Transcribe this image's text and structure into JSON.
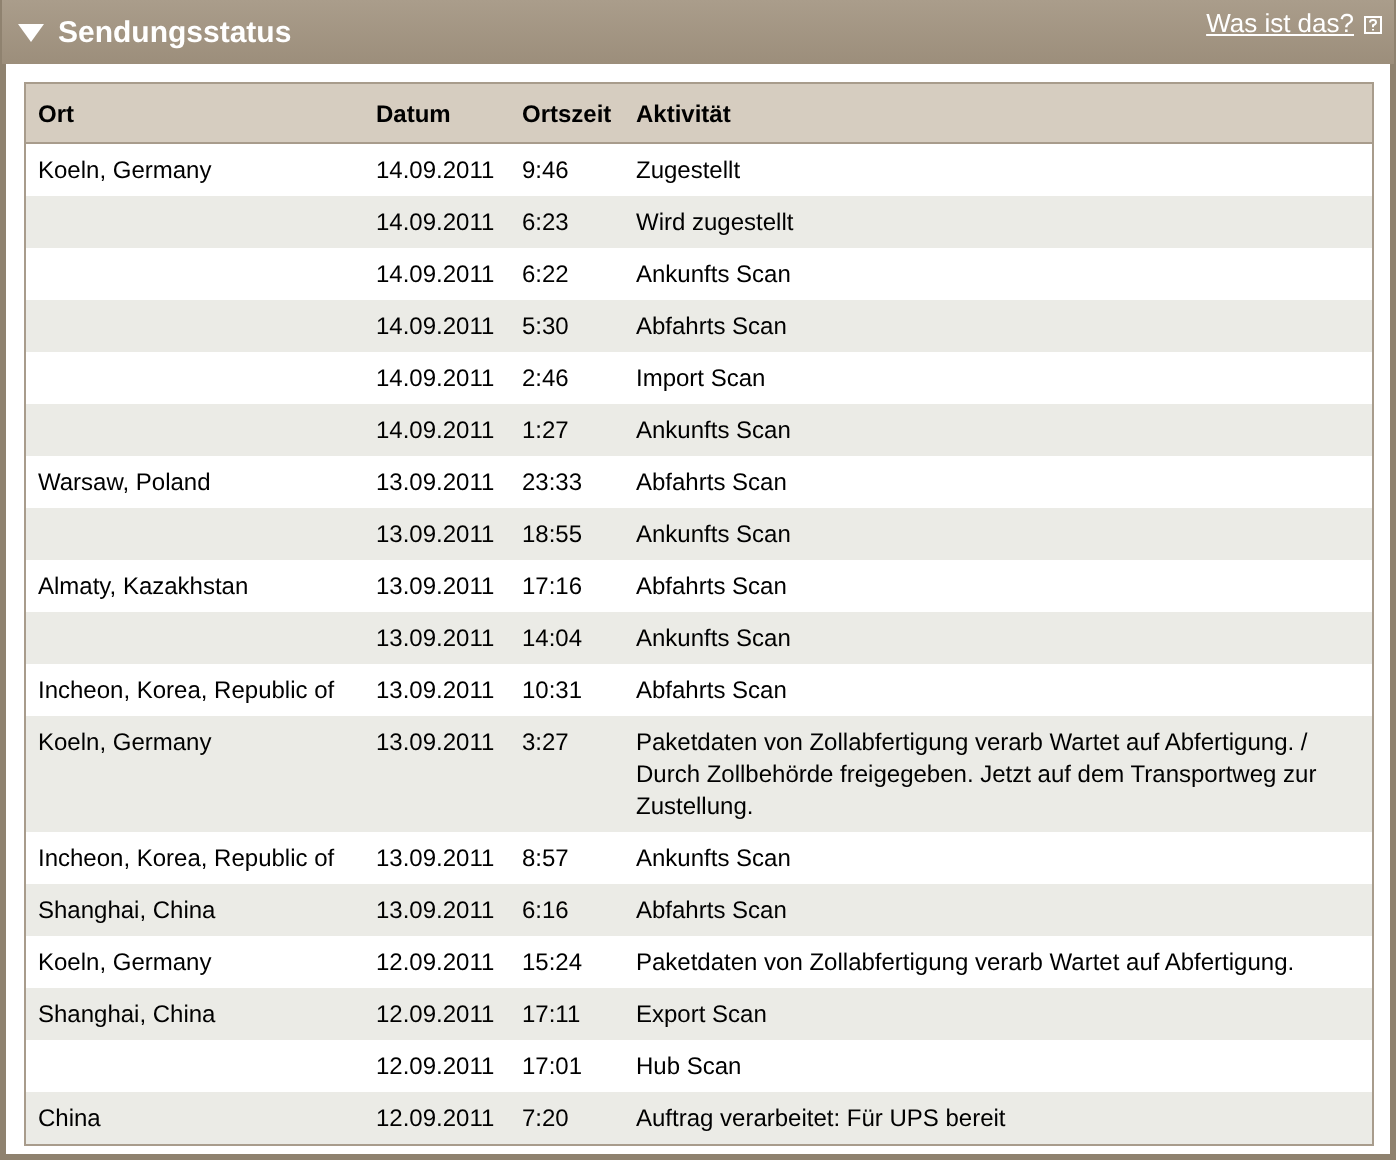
{
  "panel": {
    "title": "Sendungsstatus",
    "expanded": true,
    "help_link": "Was ist das?"
  },
  "table": {
    "columns": [
      "Ort",
      "Datum",
      "Ortszeit",
      "Aktivität"
    ],
    "rows": [
      {
        "place": "Koeln, Germany",
        "date": "14.09.2011",
        "time": "9:46",
        "activity": "Zugestellt"
      },
      {
        "date": "14.09.2011",
        "time": "6:23",
        "activity": "Wird zugestellt"
      },
      {
        "date": "14.09.2011",
        "time": "6:22",
        "activity": "Ankunfts Scan"
      },
      {
        "date": "14.09.2011",
        "time": "5:30",
        "activity": "Abfahrts Scan"
      },
      {
        "date": "14.09.2011",
        "time": "2:46",
        "activity": "Import Scan"
      },
      {
        "date": "14.09.2011",
        "time": "1:27",
        "activity": "Ankunfts Scan"
      },
      {
        "place": "Warsaw, Poland",
        "date": "13.09.2011",
        "time": "23:33",
        "activity": "Abfahrts Scan"
      },
      {
        "date": "13.09.2011",
        "time": "18:55",
        "activity": "Ankunfts Scan"
      },
      {
        "place": "Almaty, Kazakhstan",
        "date": "13.09.2011",
        "time": "17:16",
        "activity": "Abfahrts Scan"
      },
      {
        "date": "13.09.2011",
        "time": "14:04",
        "activity": "Ankunfts Scan"
      },
      {
        "place": "Incheon, Korea, Republic of",
        "date": "13.09.2011",
        "time": "10:31",
        "activity": "Abfahrts Scan"
      },
      {
        "place": "Koeln, Germany",
        "date": "13.09.2011",
        "time": "3:27",
        "activity": "Paketdaten von Zollabfertigung verarb Wartet auf Abfertigung. / Durch Zollbehörde freigegeben. Jetzt auf dem Transportweg zur Zustellung."
      },
      {
        "place": "Incheon, Korea, Republic of",
        "date": "13.09.2011",
        "time": "8:57",
        "activity": "Ankunfts Scan"
      },
      {
        "place": "Shanghai, China",
        "date": "13.09.2011",
        "time": "6:16",
        "activity": "Abfahrts Scan"
      },
      {
        "place": "Koeln, Germany",
        "date": "12.09.2011",
        "time": "15:24",
        "activity": "Paketdaten von Zollabfertigung verarb Wartet auf Abfertigung."
      },
      {
        "place": "Shanghai, China",
        "date": "12.09.2011",
        "time": "17:11",
        "activity": "Export Scan"
      },
      {
        "date": "12.09.2011",
        "time": "17:01",
        "activity": "Hub Scan"
      },
      {
        "place": "China",
        "date": "12.09.2011",
        "time": "7:20",
        "activity": "Auftrag verarbeitet: Für UPS bereit"
      }
    ]
  }
}
